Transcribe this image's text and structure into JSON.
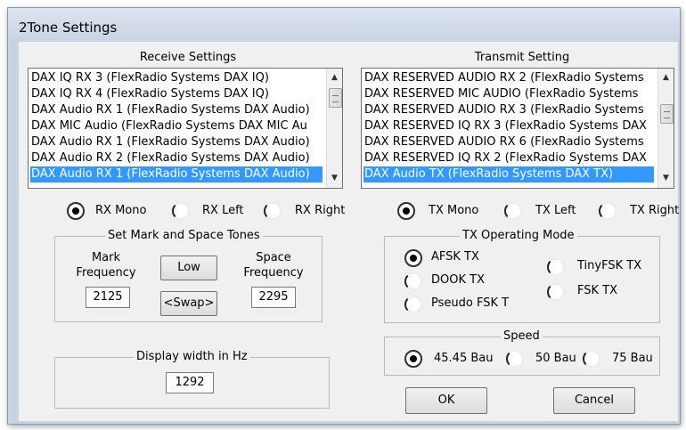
{
  "window": {
    "title": "2Tone Settings"
  },
  "receive": {
    "header": "Receive Settings",
    "items": [
      "DAX IQ RX 3 (FlexRadio Systems DAX IQ)",
      "DAX IQ RX 4 (FlexRadio Systems DAX IQ)",
      "DAX Audio RX 1 (FlexRadio Systems DAX Audio)",
      "DAX MIC Audio (FlexRadio Systems DAX MIC Au",
      "DAX Audio RX 1 (FlexRadio Systems DAX Audio)",
      "DAX Audio RX 2 (FlexRadio Systems DAX Audio)",
      "DAX Audio RX 1 (FlexRadio Systems DAX Audio)"
    ],
    "selected_index": 6,
    "radios": [
      {
        "label": "RX Mono",
        "checked": true
      },
      {
        "label": "RX Left",
        "checked": false
      },
      {
        "label": "RX Right",
        "checked": false
      }
    ]
  },
  "transmit": {
    "header": "Transmit Setting",
    "items": [
      "DAX RESERVED AUDIO RX 2 (FlexRadio Systems",
      "DAX RESERVED MIC AUDIO (FlexRadio Systems",
      "DAX RESERVED AUDIO RX 3 (FlexRadio Systems",
      "DAX RESERVED IQ RX 3 (FlexRadio Systems DAX",
      "DAX RESERVED AUDIO RX 6 (FlexRadio Systems",
      "DAX RESERVED IQ RX 2 (FlexRadio Systems DAX",
      "DAX Audio TX (FlexRadio Systems DAX TX)"
    ],
    "selected_index": 6,
    "radios": [
      {
        "label": "TX Mono",
        "checked": true
      },
      {
        "label": "TX Left",
        "checked": false
      },
      {
        "label": "TX Right",
        "checked": false
      }
    ]
  },
  "tones": {
    "legend": "Set Mark and Space Tones",
    "mark_label_1": "Mark",
    "mark_label_2": "Frequency",
    "mark_value": "2125",
    "space_label_1": "Space",
    "space_label_2": "Frequency",
    "space_value": "2295",
    "low_button": "Low",
    "swap_button": "<Swap>"
  },
  "display": {
    "legend": "Display width in Hz",
    "value": "1292"
  },
  "tx_mode": {
    "legend": "TX Operating Mode",
    "options": [
      {
        "label": "AFSK TX",
        "checked": true
      },
      {
        "label": "DOOK TX",
        "checked": false
      },
      {
        "label": "Pseudo FSK T",
        "checked": false
      },
      {
        "label": "TinyFSK TX",
        "checked": false
      },
      {
        "label": "FSK TX",
        "checked": false
      }
    ]
  },
  "speed": {
    "legend": "Speed",
    "options": [
      {
        "label": "45.45 Bau",
        "checked": true
      },
      {
        "label": "50 Bau",
        "checked": false
      },
      {
        "label": "75 Bau",
        "checked": false
      }
    ]
  },
  "buttons": {
    "ok": "OK",
    "cancel": "Cancel"
  },
  "scroll_glyphs": {
    "up": "▲",
    "down": "▼"
  }
}
